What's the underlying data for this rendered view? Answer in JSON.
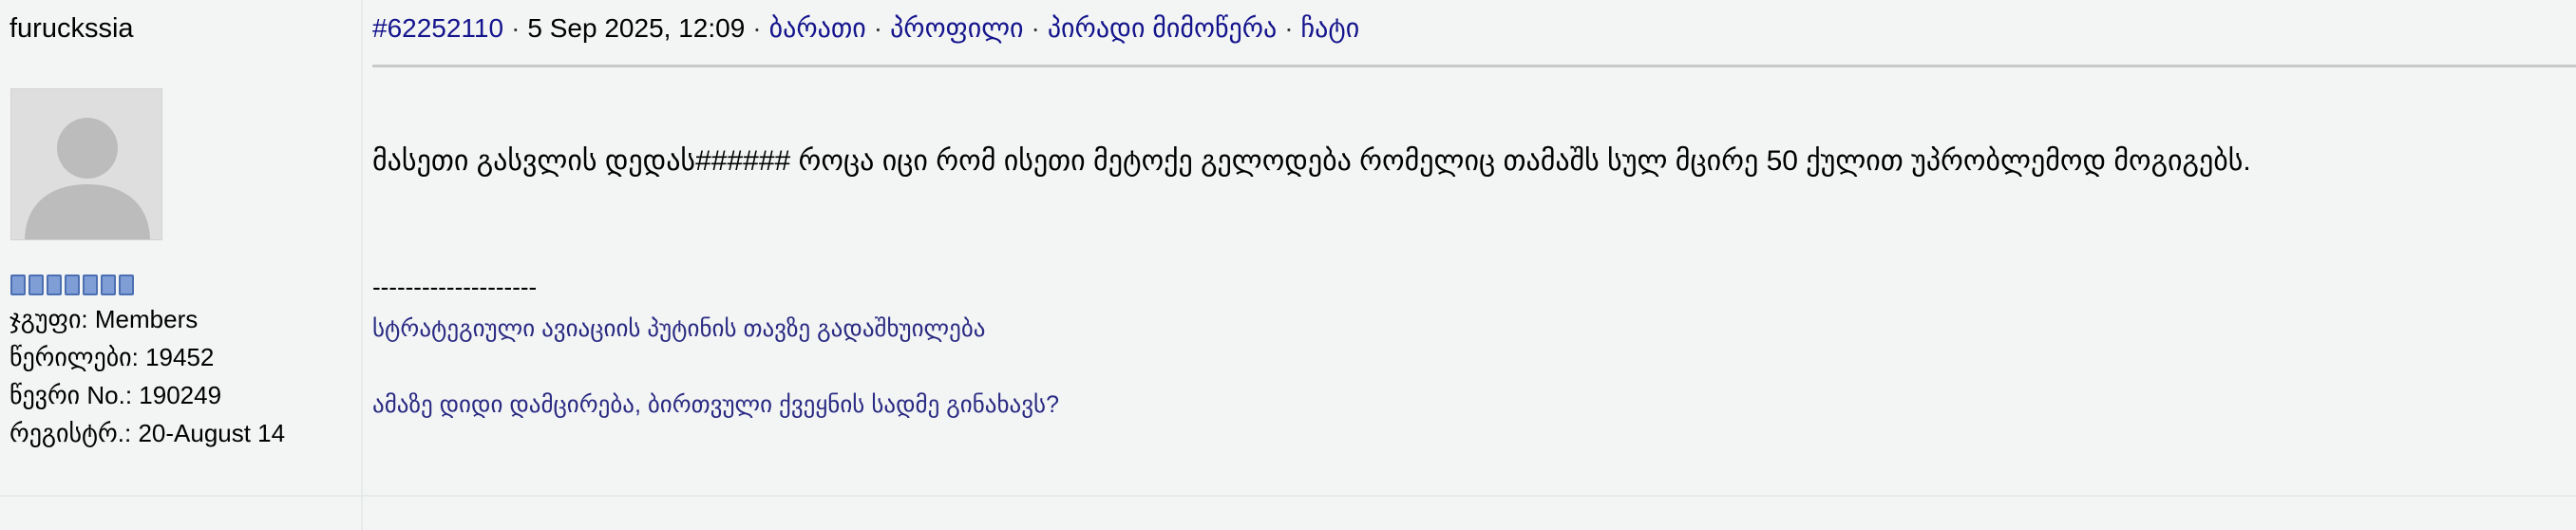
{
  "author": {
    "username": "furuckssia",
    "group_label": "ჯგუფი:",
    "group_value": "Members",
    "posts_label": "წერილები:",
    "posts_value": "19452",
    "member_no_label": "წევრი No.:",
    "member_no_value": "190249",
    "registered_label": "რეგისტრ.:",
    "registered_value": "20-August 14",
    "rank_pips": 7,
    "rank_color": "#7f9ed6"
  },
  "post": {
    "id": "#62252110",
    "date": "5 Sep 2025, 12:09",
    "links": {
      "card": "ბარათი",
      "profile": "პროფილი",
      "private_message": "პირადი მიმოწერა",
      "chat": "ჩატი"
    },
    "message": "მასეთი გასვლის დედას###### როცა იცი რომ ისეთი მეტოქე გელოდება რომელიც თამაშს სულ მცირე 50 ქულით უპრობლემოდ მოგიგებს.",
    "signature": {
      "dashes": "--------------------",
      "line1": "სტრატეგიული ავიაციის პუტინის თავზე გადაშხუილება",
      "line2": "ამაზე დიდი დამცირება, ბირთვული ქვეყნის სადმე გინახავს?"
    }
  },
  "colors": {
    "link": "#14148c",
    "signature": "#2a2a82",
    "background": "#f3f5f5"
  }
}
